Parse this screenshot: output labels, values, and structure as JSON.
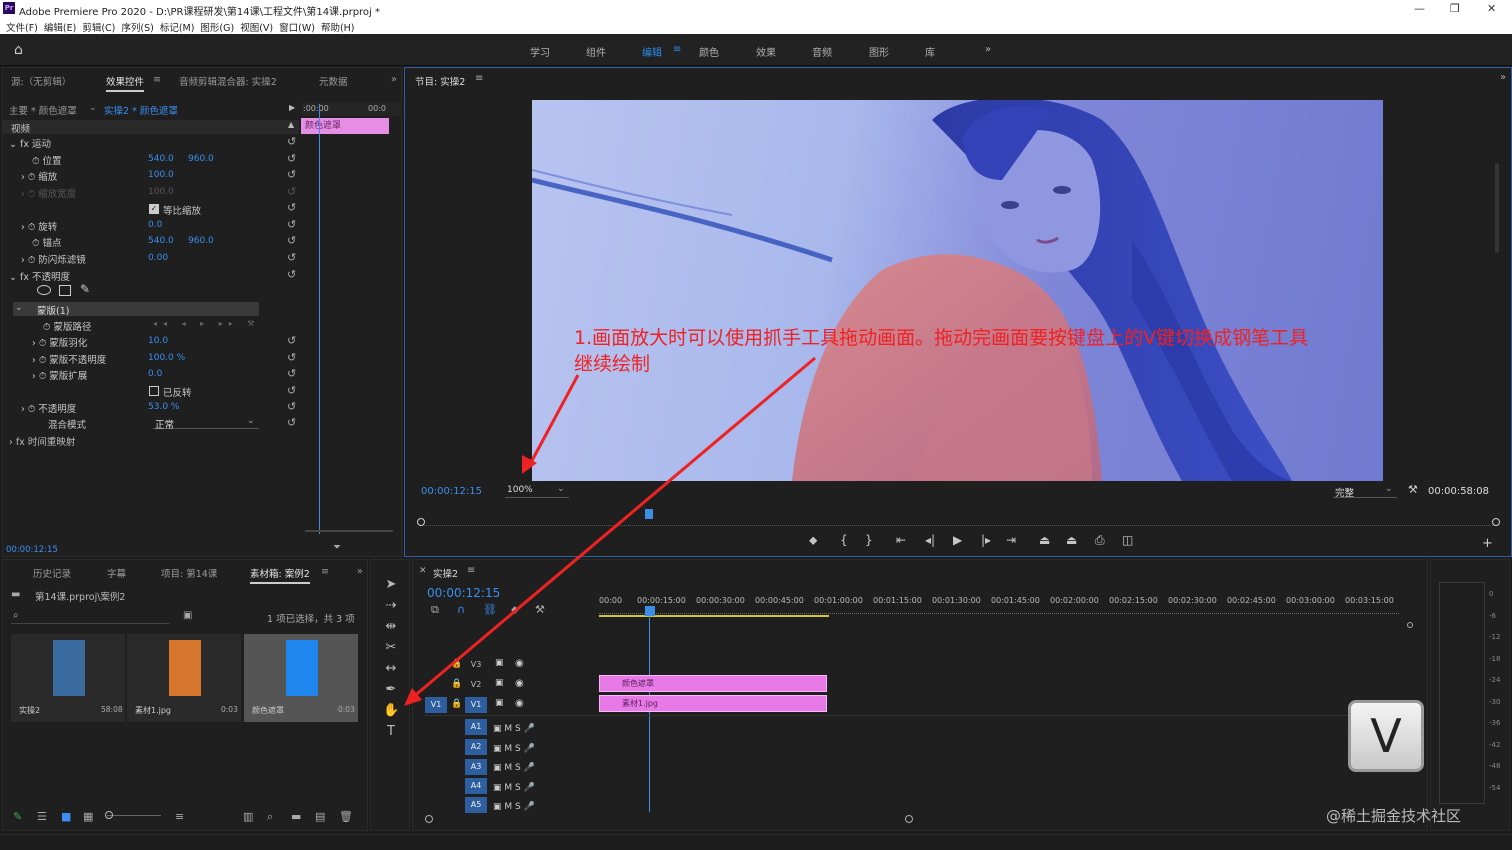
{
  "window": {
    "app": "Adobe Premiere Pro 2020",
    "path": "D:\\PR课程研发\\第14课\\工程文件\\第14课.prproj *",
    "min": "—",
    "max": "❐",
    "close": "✕"
  },
  "menu": [
    "文件(F)",
    "编辑(E)",
    "剪辑(C)",
    "序列(S)",
    "标记(M)",
    "图形(G)",
    "视图(V)",
    "窗口(W)",
    "帮助(H)"
  ],
  "workspaces": [
    "学习",
    "组件",
    "编辑",
    "颜色",
    "效果",
    "音频",
    "图形",
    "库"
  ],
  "workspace_active": "编辑",
  "source_panel": {
    "tabs": [
      "源:（无剪辑）",
      "效果控件",
      "音频剪辑混合器: 实操2",
      "元数据"
    ],
    "active_tab": "效果控件",
    "master": "主要 * 颜色遮罩",
    "clip": "实操2 * 颜色遮罩",
    "ruler_start": ":00:00",
    "ruler_end": "00:0",
    "clip_bar_label": "颜色遮罩",
    "section_video": "视频",
    "props": [
      {
        "name": "fx 运动",
        "v1": "",
        "v2": ""
      },
      {
        "name": "位置",
        "v1": "540.0",
        "v2": "960.0"
      },
      {
        "name": "缩放",
        "v1": "100.0",
        "v2": ""
      },
      {
        "name": "缩放宽度",
        "v1": "100.0",
        "v2": ""
      },
      {
        "name": "等比缩放",
        "v1": "",
        "v2": ""
      },
      {
        "name": "旋转",
        "v1": "0.0",
        "v2": ""
      },
      {
        "name": "锚点",
        "v1": "540.0",
        "v2": "960.0"
      },
      {
        "name": "防闪烁滤镜",
        "v1": "0.00",
        "v2": ""
      },
      {
        "name": "fx 不透明度",
        "v1": "",
        "v2": ""
      },
      {
        "name": "",
        "v1": "",
        "v2": ""
      },
      {
        "name": "蒙版(1)",
        "v1": "",
        "v2": ""
      },
      {
        "name": "蒙版路径",
        "v1": "",
        "v2": ""
      },
      {
        "name": "蒙版羽化",
        "v1": "10.0",
        "v2": ""
      },
      {
        "name": "蒙版不透明度",
        "v1": "100.0 %",
        "v2": ""
      },
      {
        "name": "蒙版扩展",
        "v1": "0.0",
        "v2": ""
      },
      {
        "name": "已反转",
        "v1": "",
        "v2": ""
      },
      {
        "name": "不透明度",
        "v1": "53.0 %",
        "v2": ""
      },
      {
        "name": "混合模式",
        "v1": "正常",
        "v2": ""
      },
      {
        "name": "fx 时间重映射",
        "v1": "",
        "v2": ""
      }
    ],
    "timecode": "00:00:12:15"
  },
  "program_monitor": {
    "title": "节目: 实操2",
    "timecode": "00:00:12:15",
    "zoom": "100%",
    "quality": "完整",
    "duration": "00:00:58:08"
  },
  "annotation": {
    "line1": "1.画面放大时可以使用抓手工具拖动画面。拖动完画面要按键盘上的V键切换成钢笔工具",
    "line2": "继续绘制",
    "key": "V"
  },
  "project_panel": {
    "tabs": [
      "历史记录",
      "字幕",
      "项目: 第14课",
      "素材箱: 案例2"
    ],
    "active_tab": "素材箱: 案例2",
    "path": "第14课.prproj\\案例2",
    "count": "1 项已选择，共 3 项",
    "items": [
      {
        "name": "实操2",
        "dur": "58:08",
        "color": "#3a6b9e"
      },
      {
        "name": "素材1.jpg",
        "dur": "0:03",
        "color": "#d7762d"
      },
      {
        "name": "颜色遮罩",
        "dur": "0:03",
        "color": "#1f86f0"
      }
    ]
  },
  "timeline": {
    "title": "实操2",
    "timecode": "00:00:12:15",
    "ruler": [
      "00:00",
      "00:00:15:00",
      "00:00:30:00",
      "00:00:45:00",
      "00:01:00:00",
      "00:01:15:00",
      "00:01:30:00",
      "00:01:45:00",
      "00:02:00:00",
      "00:02:15:00",
      "00:02:30:00",
      "00:02:45:00",
      "00:03:00:00",
      "00:03:15:00"
    ],
    "video_tracks": [
      "V3",
      "V2",
      "V1"
    ],
    "audio_tracks": [
      "A1",
      "A2",
      "A3",
      "A4",
      "A5"
    ],
    "clip_v2": "颜色遮罩",
    "clip_v1": "素材1.jpg",
    "meter_labels": [
      "0",
      "-6",
      "-12",
      "-18",
      "-24",
      "-30",
      "-36",
      "-42",
      "-48",
      "-54"
    ],
    "src_patch": "V1"
  },
  "watermark": "@稀土掘金技术社区"
}
